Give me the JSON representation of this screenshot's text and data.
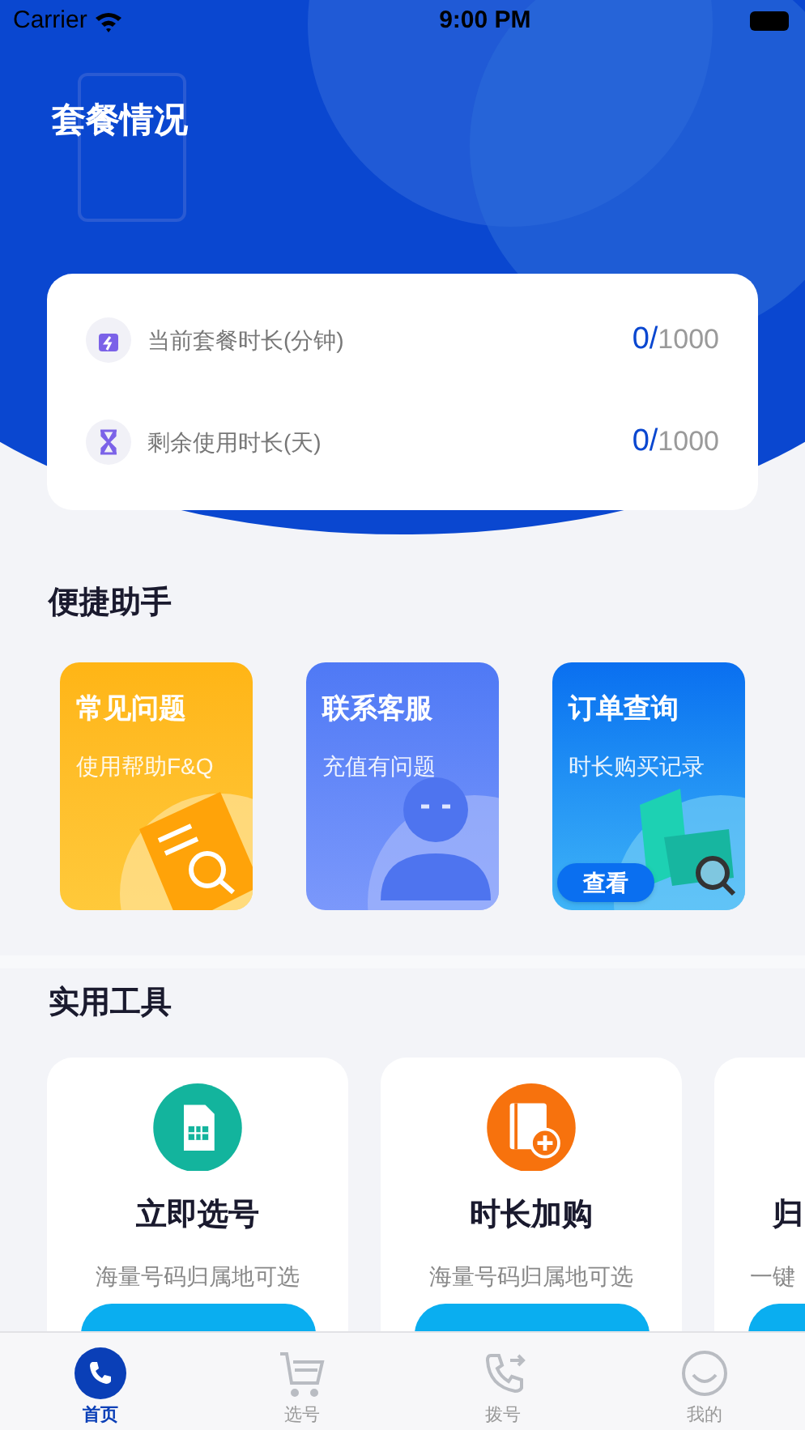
{
  "status_bar": {
    "carrier": "Carrier",
    "time": "9:00 PM"
  },
  "header": {
    "title": "套餐情况"
  },
  "plan": [
    {
      "kind": "bolt",
      "label": "当前套餐时长(分钟)",
      "used": "0/",
      "total": "1000"
    },
    {
      "kind": "hourglass",
      "label": "剩余使用时长(天)",
      "used": "0/",
      "total": "1000"
    }
  ],
  "assistant": {
    "title": "便捷助手",
    "cards": [
      {
        "kind": "faq",
        "title": "常见问题",
        "subtitle": "使用帮助F&Q"
      },
      {
        "kind": "service",
        "title": "联系客服",
        "subtitle": "充值有问题"
      },
      {
        "kind": "orders",
        "title": "订单查询",
        "subtitle": "时长购买记录",
        "button": "查看"
      }
    ]
  },
  "tools": {
    "title": "实用工具",
    "cards": [
      {
        "kind": "sim",
        "title": "立即选号",
        "subtitle": "海量号码归属地可选"
      },
      {
        "kind": "topup",
        "title": "时长加购",
        "subtitle": "海量号码归属地可选"
      },
      {
        "kind": "partial",
        "title": "归",
        "subtitle": "一键"
      }
    ]
  },
  "tabs": [
    {
      "kind": "phone",
      "label": "首页",
      "selected": true
    },
    {
      "kind": "cart",
      "label": "选号",
      "selected": false
    },
    {
      "kind": "dial",
      "label": "拨号",
      "selected": false
    },
    {
      "kind": "smile",
      "label": "我的",
      "selected": false
    }
  ]
}
